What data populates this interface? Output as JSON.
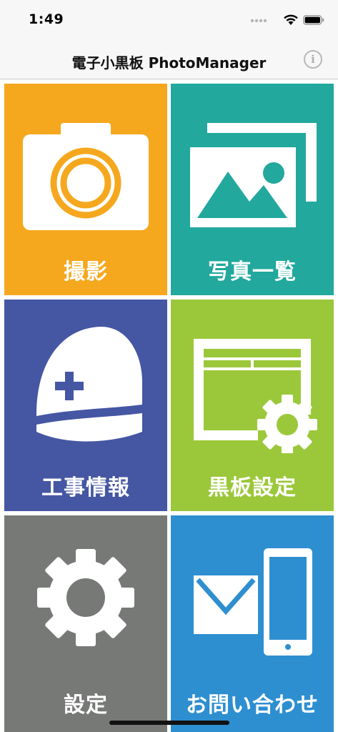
{
  "status_bar": {
    "time": "1:49",
    "icons": [
      "signal-dots-icon",
      "wifi-icon",
      "battery-icon"
    ]
  },
  "nav": {
    "title": "電子小黒板 PhotoManager",
    "info_label": "i"
  },
  "tiles": [
    {
      "label": "撮影",
      "icon": "camera-icon",
      "color": "#f5a81e"
    },
    {
      "label": "写真一覧",
      "icon": "photos-icon",
      "color": "#22a89d"
    },
    {
      "label": "工事情報",
      "icon": "helmet-icon",
      "color": "#4556a3"
    },
    {
      "label": "黒板設定",
      "icon": "blackboard-settings-icon",
      "color": "#9bc83a"
    },
    {
      "label": "設定",
      "icon": "gear-icon",
      "color": "#777977"
    },
    {
      "label": "お問い合わせ",
      "icon": "contact-icon",
      "color": "#2e8fd0"
    }
  ]
}
